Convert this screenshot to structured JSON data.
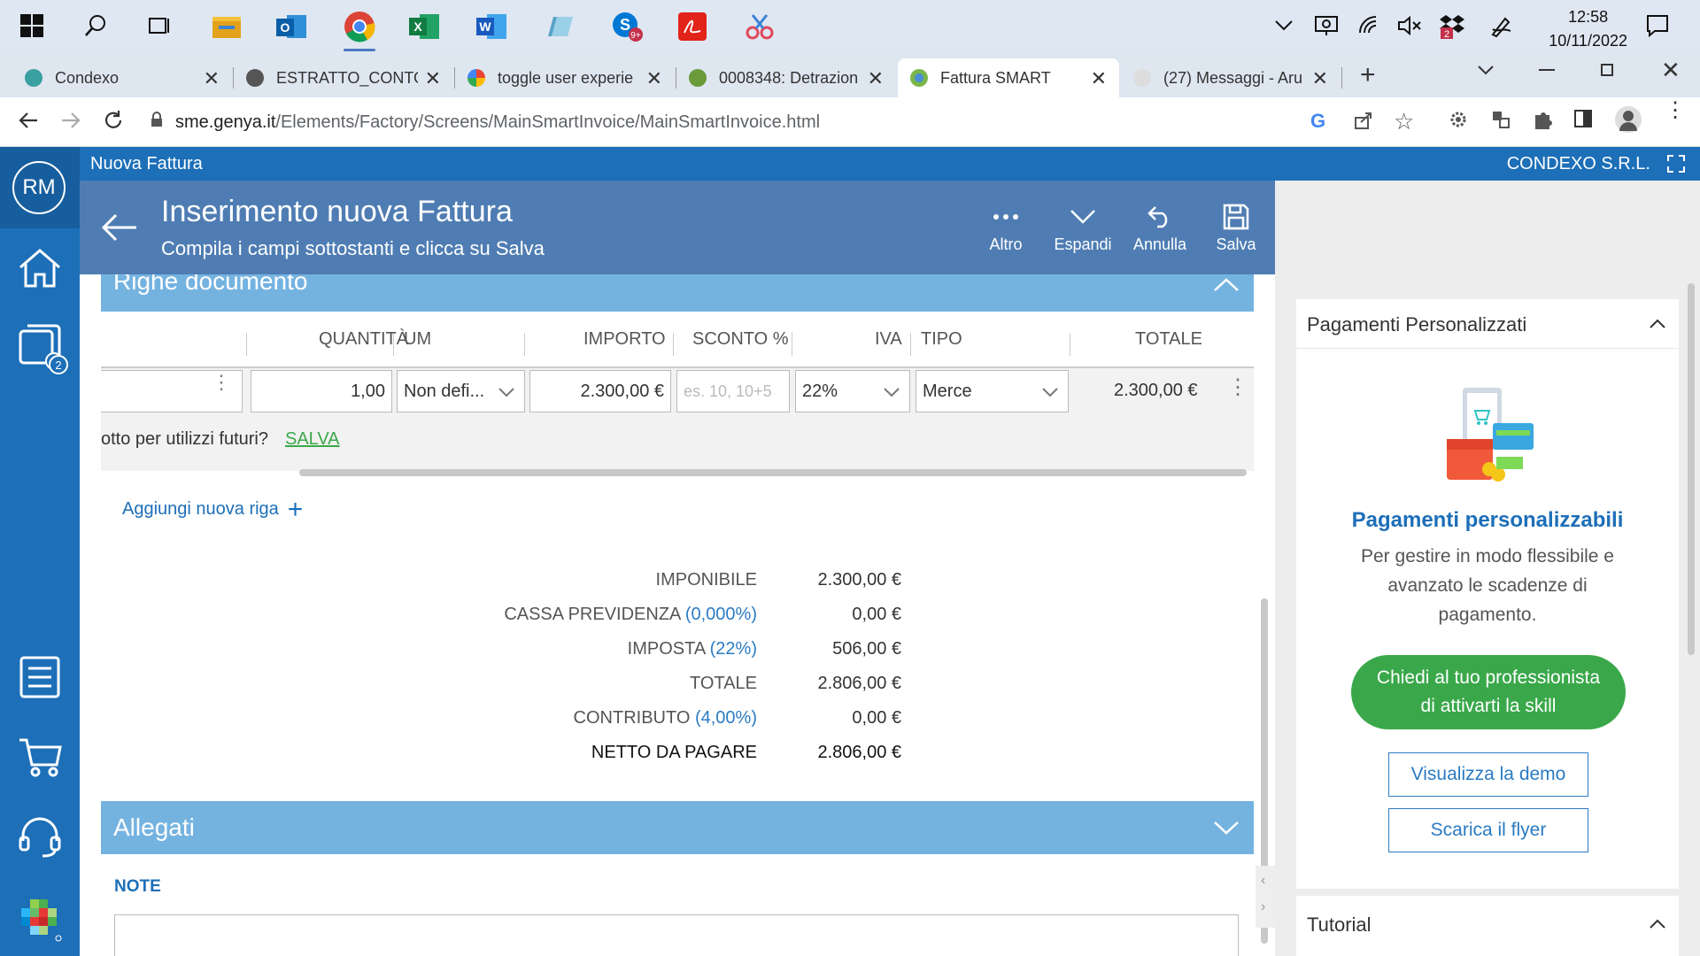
{
  "taskbar": {
    "time": "12:58",
    "date": "10/11/2022",
    "notif_badge_skype": "9+",
    "notif_badge_dropbox": "2"
  },
  "tabs": [
    {
      "label": "Condexo",
      "color": "#3aa0a0"
    },
    {
      "label": "ESTRATTO_CONTO_",
      "color": "#555555"
    },
    {
      "label": "toggle user experie",
      "color": "#4285f4"
    },
    {
      "label": "0008348: Detrazion",
      "color": "#6a9a3a"
    },
    {
      "label": "Fattura SMART",
      "color": "#7ab648"
    },
    {
      "label": "(27) Messaggi - Aru",
      "color": "#cccccc"
    }
  ],
  "address": {
    "host": "sme.genya.it",
    "path": "/Elements/Factory/Screens/MainSmartInvoice/MainSmartInvoice.html"
  },
  "appbar": {
    "title": "Nuova Fattura",
    "company": "CONDEXO S.R.L."
  },
  "sidebar": {
    "avatar": "RM",
    "badge": "2"
  },
  "header": {
    "title": "Inserimento nuova Fattura",
    "subtitle": "Compila i campi sottostanti e clicca su Salva",
    "actions": {
      "altro": "Altro",
      "espandi": "Espandi",
      "annulla": "Annulla",
      "salva": "Salva"
    }
  },
  "righe": {
    "section_title": "Righe documento",
    "columns": {
      "quantita": "QUANTITÀ",
      "um": "UM",
      "importo": "IMPORTO",
      "sconto": "SCONTO %",
      "iva": "IVA",
      "tipo": "TIPO",
      "totale": "TOTALE"
    },
    "row": {
      "quantita": "1,00",
      "um": "Non defi...",
      "importo": "2.300,00 €",
      "sconto_placeholder": "es. 10, 10+5",
      "iva": "22%",
      "tipo": "Merce",
      "totale": "2.300,00 €"
    },
    "save_prompt": "otto per utilizzi futuri?",
    "save_link": "SALVA",
    "add_row": "Aggiungi nuova riga"
  },
  "summary": {
    "imponibile_label": "IMPONIBILE",
    "imponibile": "2.300,00 €",
    "cassa_label": "CASSA PREVIDENZA",
    "cassa_pct": "(0,000%)",
    "cassa": "0,00 €",
    "imposta_label": "IMPOSTA",
    "imposta_pct": "(22%)",
    "imposta": "506,00 €",
    "totale_label": "TOTALE",
    "totale": "2.806,00 €",
    "contributo_label": "CONTRIBUTO",
    "contributo_pct": "(4,00%)",
    "contributo": "0,00 €",
    "netto_label": "NETTO DA PAGARE",
    "netto": "2.806,00 €"
  },
  "allegati": {
    "title": "Allegati",
    "note_label": "NOTE"
  },
  "right": {
    "card_title": "Pagamenti Personalizzati",
    "promo_title": "Pagamenti personalizzabili",
    "promo_text_1": "Per gestire in modo flessibile e",
    "promo_text_2": "avanzato le scadenze di",
    "promo_text_3": "pagamento.",
    "cta_line1": "Chiedi al tuo professionista",
    "cta_line2": "di attivarti la skill",
    "demo": "Visualizza la demo",
    "flyer": "Scarica il flyer",
    "tutorial": "Tutorial"
  },
  "colors": {
    "primary": "#1d6fb8",
    "header": "#4f7db3",
    "section": "#74b3e0",
    "cta": "#3aa84a",
    "link_green": "#3aa84a"
  }
}
